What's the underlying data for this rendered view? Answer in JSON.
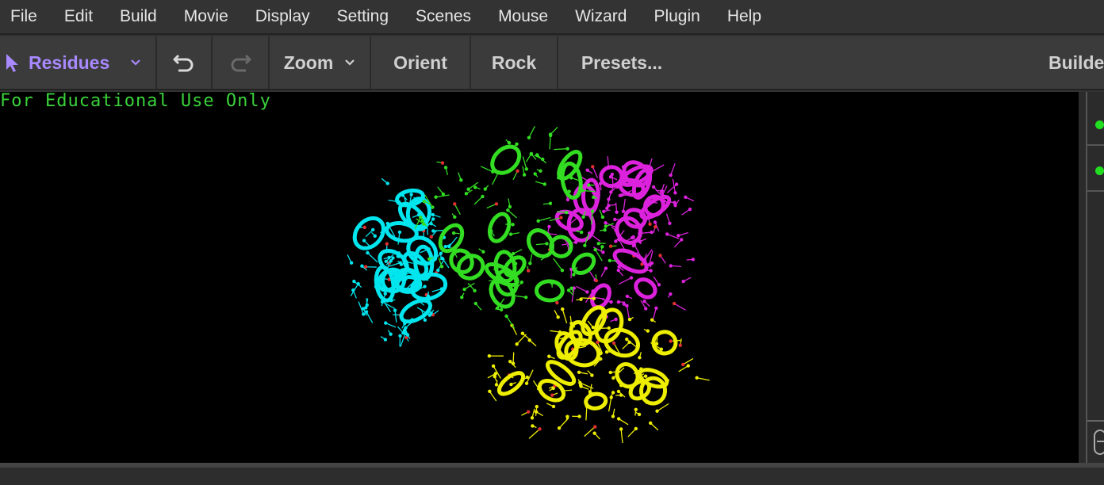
{
  "menu": [
    "File",
    "Edit",
    "Build",
    "Movie",
    "Display",
    "Setting",
    "Scenes",
    "Mouse",
    "Wizard",
    "Plugin",
    "Help"
  ],
  "toolbar": {
    "mode_label": "Residues",
    "zoom_label": "Zoom",
    "orient_label": "Orient",
    "rock_label": "Rock",
    "presets_label": "Presets...",
    "builder_label": "Builde"
  },
  "viewer": {
    "overlay_text": "For Educational Use Only",
    "chain_colors": [
      "#00e5ee",
      "#33dd22",
      "#dd22dd",
      "#eeee00"
    ]
  },
  "colors": {
    "mode_accent": "#a889ff",
    "overlay_green": "#3ad23a",
    "status_dot": "#22dd22"
  }
}
